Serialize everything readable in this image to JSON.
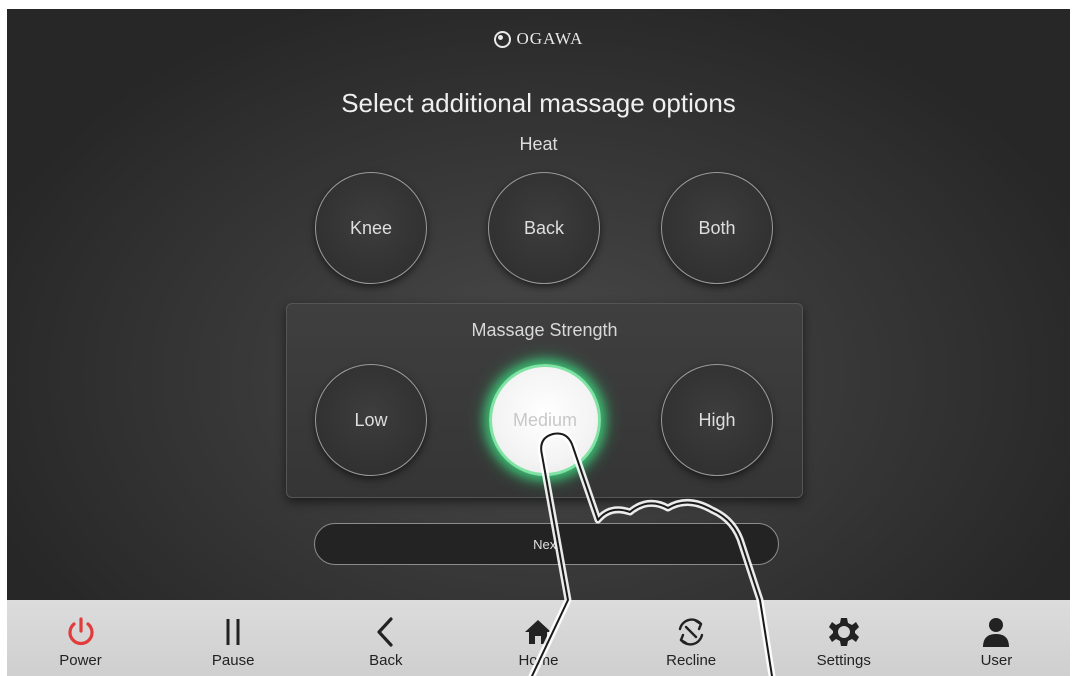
{
  "logo": {
    "text": "OGAWA"
  },
  "title": "Select additional massage options",
  "heat": {
    "label": "Heat",
    "options": [
      "Knee",
      "Back",
      "Both"
    ]
  },
  "strength": {
    "label": "Massage Strength",
    "options": [
      "Low",
      "Medium",
      "High"
    ],
    "selected": "Medium"
  },
  "next_label": "Next",
  "nav": [
    {
      "label": "Power",
      "icon": "power-icon",
      "color": "#e23b3b"
    },
    {
      "label": "Pause",
      "icon": "pause-icon",
      "color": "#222222"
    },
    {
      "label": "Back",
      "icon": "back-icon",
      "color": "#222222"
    },
    {
      "label": "Home",
      "icon": "home-icon",
      "color": "#222222"
    },
    {
      "label": "Recline",
      "icon": "recline-icon",
      "color": "#222222"
    },
    {
      "label": "Settings",
      "icon": "settings-icon",
      "color": "#222222"
    },
    {
      "label": "User",
      "icon": "user-icon",
      "color": "#222222"
    }
  ],
  "colors": {
    "selected_glow": "#3cc878",
    "power": "#e23b3b"
  }
}
